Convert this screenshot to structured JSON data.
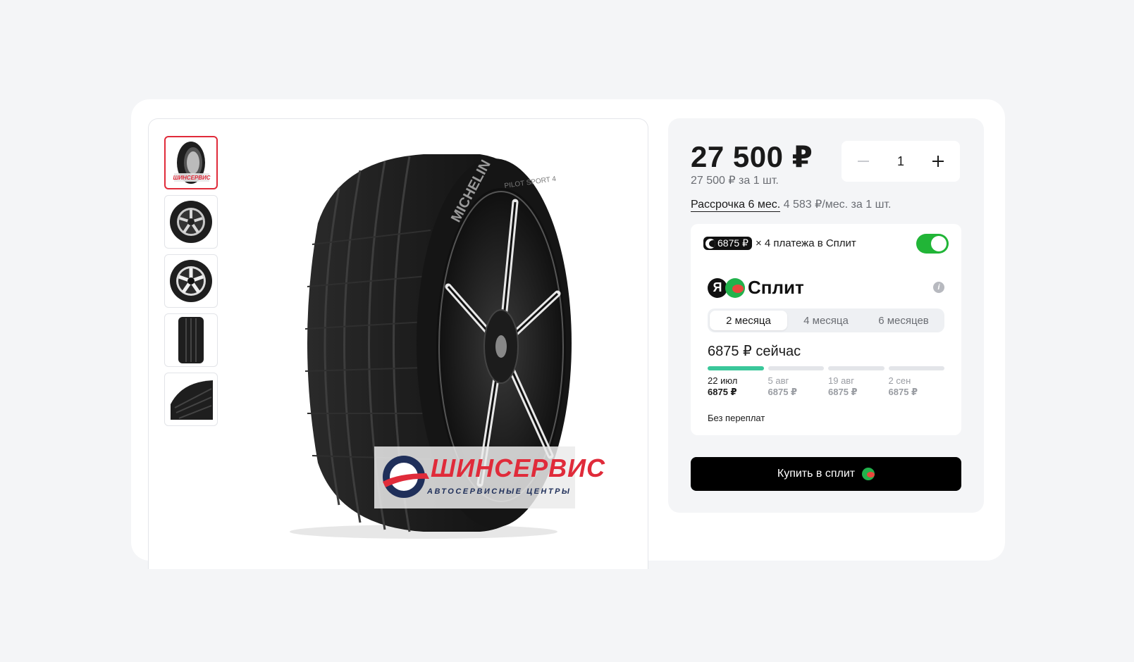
{
  "product": {
    "price": "27 500 ₽",
    "price_per_unit": "27 500 ₽ за 1 шт.",
    "quantity": "1",
    "installment_link": "Рассрочка 6 мес.",
    "installment_amount": "4 583 ₽/мес. за 1 шт."
  },
  "gallery": {
    "watermark_brand": "ШИНСЕРВИС",
    "watermark_sub": "АВТОСЕРВИСНЫЕ ЦЕНТРЫ",
    "tyre_brand": "MICHELIN",
    "tyre_model": "PILOT SPORT 4",
    "thumb_count": 5,
    "active_thumb": 0
  },
  "split": {
    "pill_amount": "6875 ₽",
    "payments_text": "× 4 платежа в Сплит",
    "toggle_on": true,
    "logo_letter": "Я",
    "logo_word": "Сплит",
    "tabs": [
      "2 месяца",
      "4 месяца",
      "6 месяцев"
    ],
    "active_tab": 0,
    "now_text": "6875 ₽ сейчас",
    "schedule": [
      {
        "date": "22 июл",
        "amount": "6875 ₽"
      },
      {
        "date": "5 авг",
        "amount": "6875 ₽"
      },
      {
        "date": "19 авг",
        "amount": "6875 ₽"
      },
      {
        "date": "2 сен",
        "amount": "6875 ₽"
      }
    ],
    "no_overpay": "Без переплат",
    "buy_label": "Купить в сплит"
  },
  "colors": {
    "accent_green": "#21b537",
    "progress_green": "#3ac79a",
    "brand_red": "#e02b3a"
  }
}
